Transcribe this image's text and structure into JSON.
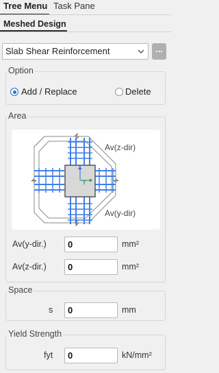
{
  "tabs": {
    "tree_menu": "Tree Menu",
    "task_pane": "Task Pane"
  },
  "subtab": {
    "label": "Meshed Design"
  },
  "select": {
    "value": "Slab Shear Reinforcement",
    "more_label": "..."
  },
  "option": {
    "title": "Option",
    "add_replace": "Add / Replace",
    "delete": "Delete",
    "selected": "add_replace"
  },
  "area": {
    "title": "Area",
    "diagram": {
      "label_z": "Av(z-dir)",
      "label_y": "Av(y-dir)",
      "axis_z": "z",
      "axis_y": "y"
    },
    "av_y": {
      "label": "Av(y-dir.)",
      "value": "0",
      "unit": "mm²"
    },
    "av_z": {
      "label": "Av(z-dir.)",
      "value": "0",
      "unit": "mm²"
    }
  },
  "space": {
    "title": "Space",
    "label": "s",
    "value": "0",
    "unit": "mm"
  },
  "yield": {
    "title": "Yield Strength",
    "label": "fyt",
    "value": "0",
    "unit": "kN/mm²"
  },
  "colors": {
    "accent": "#1e6fd9",
    "rebar": "#3f7fe8",
    "concrete": "#d8d8d8"
  }
}
